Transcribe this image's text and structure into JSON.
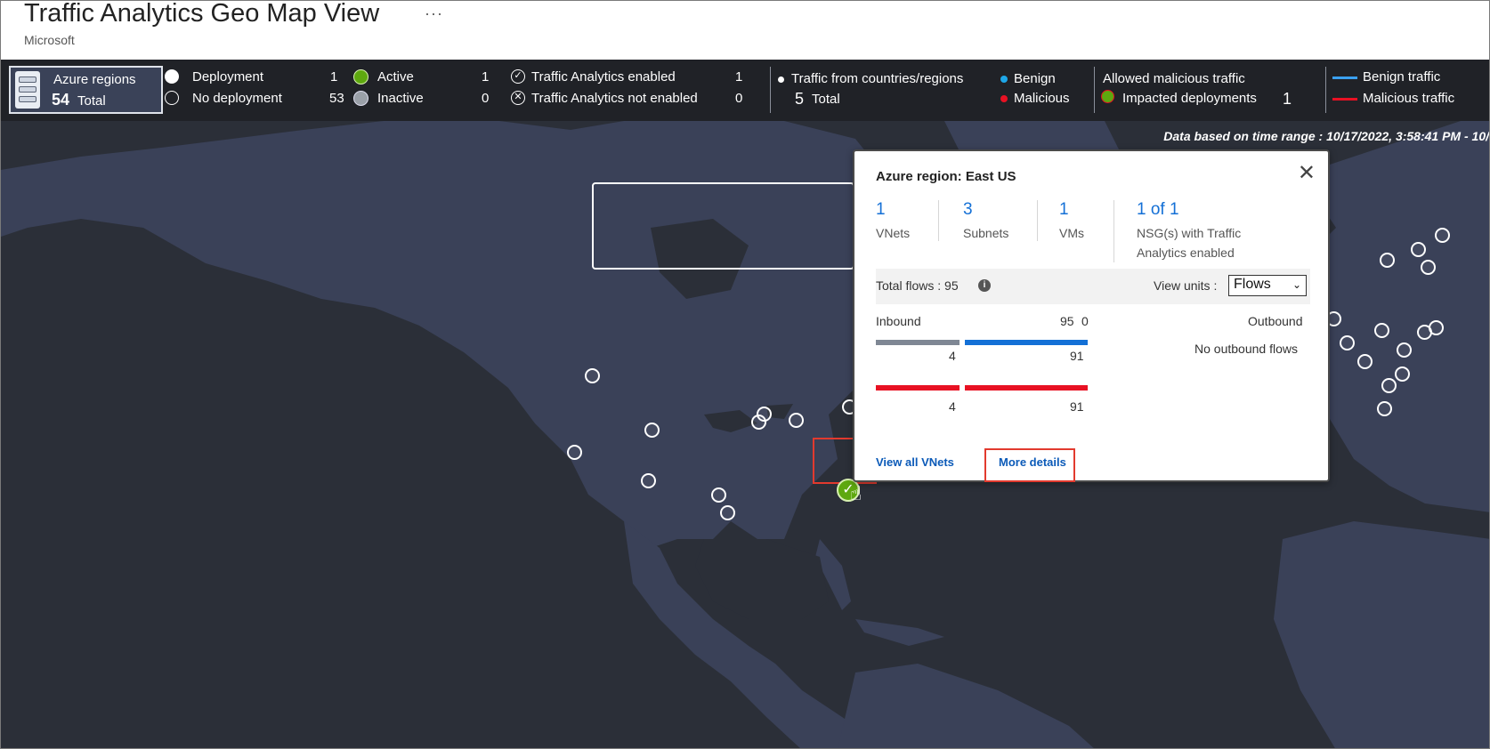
{
  "header": {
    "title": "Traffic Analytics Geo Map View",
    "ellipsis": "···",
    "subtitle": "Microsoft"
  },
  "legend": {
    "azure_regions_label": "Azure regions",
    "azure_regions_count": "54",
    "azure_regions_total": "Total",
    "deployment_label": "Deployment",
    "deployment_count": "1",
    "no_deployment_label": "No deployment",
    "no_deployment_count": "53",
    "active_label": "Active",
    "active_count": "1",
    "inactive_label": "Inactive",
    "inactive_count": "0",
    "ta_enabled_label": "Traffic Analytics enabled",
    "ta_enabled_count": "1",
    "ta_not_enabled_label": "Traffic Analytics not enabled",
    "ta_not_enabled_count": "0",
    "traffic_countries_label": "Traffic from countries/regions",
    "traffic_countries_count": "5",
    "traffic_countries_total": "Total",
    "benign_label": "Benign",
    "malicious_label": "Malicious",
    "allowed_malicious_label": "Allowed malicious traffic",
    "impacted_label": "Impacted deployments",
    "impacted_count": "1",
    "benign_traffic_label": "Benign traffic",
    "malicious_traffic_label": "Malicious traffic",
    "colors": {
      "active": "#5ea80f",
      "benign": "#1ea7e8",
      "malicious": "#e81123",
      "benign_line": "#3aa0f0",
      "malicious_line": "#e81123"
    }
  },
  "map": {
    "time_range": "Data based on time range : 10/17/2022, 3:58:41 PM - 10/"
  },
  "popup": {
    "title": "Azure region: East US",
    "stats": [
      {
        "value": "1",
        "label": "VNets"
      },
      {
        "value": "3",
        "label": "Subnets"
      },
      {
        "value": "1",
        "label": "VMs"
      },
      {
        "value": "1 of 1",
        "label_line1": "NSG(s) with Traffic",
        "label_line2": "Analytics enabled"
      }
    ],
    "total_flows": "Total flows : 95",
    "view_units_label": "View units :",
    "view_units_value": "Flows",
    "inbound_label": "Inbound",
    "inbound_total": "95",
    "outbound_total": "0",
    "outbound_label": "Outbound",
    "no_outbound": "No outbound flows",
    "benign_left": "4",
    "benign_right": "91",
    "malicious_left": "4",
    "malicious_right": "91",
    "view_all_vnets": "View all VNets",
    "more_details": "More details"
  }
}
